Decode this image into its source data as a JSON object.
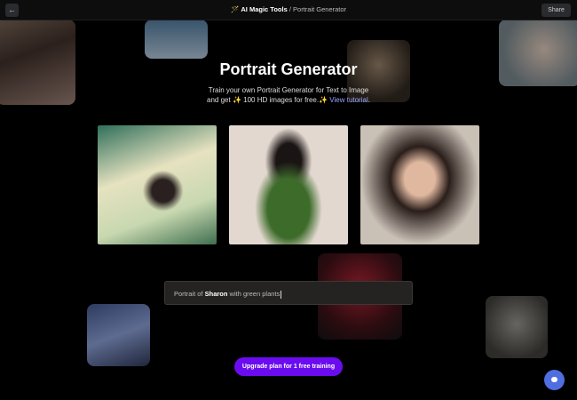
{
  "header": {
    "back_icon": "arrow-left-icon",
    "brand_icon": "magic-wand-icon",
    "breadcrumb_root": "AI Magic Tools",
    "separator": "/",
    "breadcrumb_current": "Portrait Generator",
    "share_label": "Share"
  },
  "hero": {
    "title": "Portrait Generator",
    "line1": "Train your own Portrait Generator for Text to Image",
    "line2_prefix": "and get",
    "sparkle": "✨",
    "line2_mid": "100 HD images for free.",
    "tutorial_link": "View tutorial",
    "period": "."
  },
  "prompt": {
    "prefix": "Portrait of",
    "name": "Sharon",
    "suffix": "with green plants"
  },
  "cta": {
    "label": "Upgrade plan for 1 free training"
  },
  "colors": {
    "accent": "#6b0cf0",
    "chat": "#4f6ee0",
    "link": "#9aa4ff"
  }
}
